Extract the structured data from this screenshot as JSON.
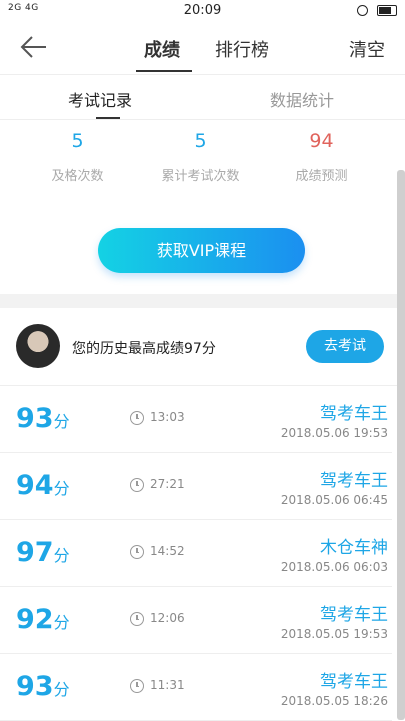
{
  "status": {
    "signal": "2G 4G",
    "time": "20:09"
  },
  "nav": {
    "tabs": [
      "成绩",
      "排行榜"
    ],
    "clear": "清空"
  },
  "subtabs": [
    "考试记录",
    "数据统计"
  ],
  "stats": [
    {
      "value": "5",
      "label": "及格次数",
      "color": "#1ea6e6"
    },
    {
      "value": "5",
      "label": "累计考试次数",
      "color": "#1ea6e6"
    },
    {
      "value": "94",
      "label": "成绩预测",
      "color": "#e0635c"
    }
  ],
  "vip_button": "获取VIP课程",
  "best": {
    "text": "您的历史最高成绩97分",
    "button": "去考试"
  },
  "score_unit": "分",
  "records": [
    {
      "score": "93",
      "duration": "13:03",
      "rank": "驾考车王",
      "date": "2018.05.06  19:53"
    },
    {
      "score": "94",
      "duration": "27:21",
      "rank": "驾考车王",
      "date": "2018.05.06  06:45"
    },
    {
      "score": "97",
      "duration": "14:52",
      "rank": "木仓车神",
      "date": "2018.05.06  06:03"
    },
    {
      "score": "92",
      "duration": "12:06",
      "rank": "驾考车王",
      "date": "2018.05.05  19:53"
    },
    {
      "score": "93",
      "duration": "11:31",
      "rank": "驾考车王",
      "date": "2018.05.05  18:26"
    }
  ]
}
